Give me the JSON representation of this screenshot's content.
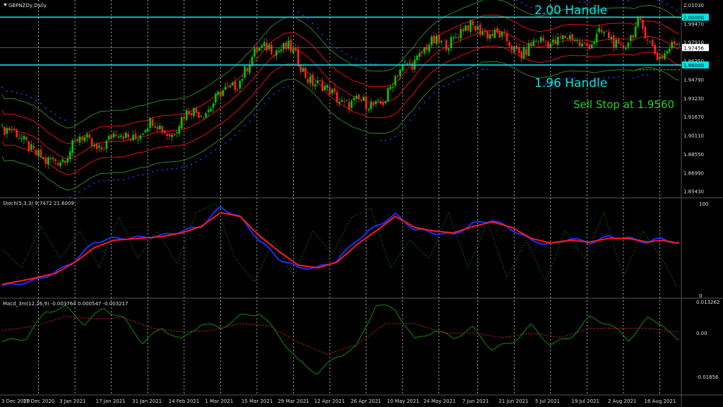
{
  "symbol_label": "GBPNZDy,Daily",
  "annotations": {
    "upper_handle": "2.00 Handle",
    "lower_handle": "1.96 Handle",
    "sell_stop": "Sell Stop at 1.9560"
  },
  "colors": {
    "background": "#000000",
    "bull_candle": "#00c800",
    "bear_candle": "#ff2020",
    "handle_line": "#00e5e5",
    "bollinger": "#2f7f2f",
    "envelope": "#e01010",
    "psar": "#2a3cff",
    "stoch_main": "#1e2dff",
    "stoch_signal": "#ff1a1a",
    "macd_main": "#0f8a0f",
    "macd_signal": "#c82020",
    "sell_stop_text": "#22d022"
  },
  "chart_data": [
    {
      "type": "candlestick",
      "title": "GBPNZDy,Daily",
      "price_axis_labels": [
        "2.01030",
        "2.00000",
        "1.99470",
        "1.97910",
        "1.97456",
        "1.96350",
        "1.96000",
        "1.94790",
        "1.93230",
        "1.91670",
        "1.90110",
        "1.88550",
        "1.86990",
        "1.85430"
      ],
      "ylim": [
        1.85,
        2.012
      ],
      "handles": [
        2.0,
        1.96
      ],
      "current_price": 1.97456,
      "sell_stop": 1.956,
      "date_labels": [
        "3 Dec 2020",
        "17 Dec 2020",
        "3 Jan 2021",
        "17 Jan 2021",
        "31 Jan 2021",
        "14 Feb 2021",
        "1 Mar 2021",
        "15 Mar 2021",
        "29 Mar 2021",
        "12 Apr 2021",
        "26 Apr 2021",
        "10 May 2021",
        "24 May 2021",
        "7 Jun 2021",
        "21 Jun 2021",
        "5 Jul 2021",
        "19 Jul 2021",
        "2 Aug 2021",
        "16 Aug 2021"
      ],
      "close_path": [
        [
          0,
          1.905
        ],
        [
          10,
          1.898
        ],
        [
          18,
          1.875
        ],
        [
          25,
          1.885
        ],
        [
          32,
          1.897
        ],
        [
          40,
          1.892
        ],
        [
          47,
          1.9
        ],
        [
          55,
          1.902
        ],
        [
          62,
          1.91
        ],
        [
          70,
          1.905
        ],
        [
          78,
          1.92
        ],
        [
          86,
          1.926
        ],
        [
          94,
          1.94
        ],
        [
          102,
          1.962
        ],
        [
          110,
          1.978
        ],
        [
          118,
          1.972
        ],
        [
          126,
          1.952
        ],
        [
          134,
          1.936
        ],
        [
          142,
          1.93
        ],
        [
          150,
          1.925
        ],
        [
          158,
          1.933
        ],
        [
          166,
          1.96
        ],
        [
          174,
          1.972
        ],
        [
          182,
          1.98
        ],
        [
          190,
          1.988
        ],
        [
          198,
          1.992
        ],
        [
          206,
          1.98
        ],
        [
          214,
          1.972
        ],
        [
          222,
          1.978
        ],
        [
          230,
          1.984
        ],
        [
          238,
          1.976
        ],
        [
          246,
          1.986
        ],
        [
          254,
          1.975
        ],
        [
          262,
          1.992
        ],
        [
          270,
          1.97
        ],
        [
          278,
          1.975
        ]
      ]
    },
    {
      "type": "line",
      "title": "Stoch(5,3,3) 9.7472 21.6009",
      "ylim": [
        0,
        100
      ],
      "y_tick_labels": [
        "100",
        "0"
      ],
      "main_path": [
        [
          0,
          10
        ],
        [
          12,
          15
        ],
        [
          22,
          25
        ],
        [
          30,
          38
        ],
        [
          38,
          58
        ],
        [
          46,
          62
        ],
        [
          56,
          63
        ],
        [
          66,
          65
        ],
        [
          74,
          70
        ],
        [
          82,
          75
        ],
        [
          90,
          96
        ],
        [
          98,
          85
        ],
        [
          106,
          60
        ],
        [
          114,
          40
        ],
        [
          122,
          30
        ],
        [
          130,
          30
        ],
        [
          138,
          38
        ],
        [
          146,
          60
        ],
        [
          154,
          75
        ],
        [
          162,
          88
        ],
        [
          170,
          72
        ],
        [
          178,
          68
        ],
        [
          186,
          66
        ],
        [
          194,
          78
        ],
        [
          202,
          82
        ],
        [
          210,
          72
        ],
        [
          218,
          60
        ],
        [
          226,
          55
        ],
        [
          234,
          62
        ],
        [
          242,
          57
        ],
        [
          250,
          64
        ],
        [
          258,
          62
        ],
        [
          266,
          58
        ],
        [
          272,
          62
        ],
        [
          278,
          57
        ]
      ],
      "signal_path": [
        [
          0,
          12
        ],
        [
          12,
          18
        ],
        [
          22,
          24
        ],
        [
          30,
          36
        ],
        [
          38,
          52
        ],
        [
          46,
          60
        ],
        [
          56,
          62
        ],
        [
          66,
          64
        ],
        [
          74,
          68
        ],
        [
          82,
          75
        ],
        [
          90,
          90
        ],
        [
          98,
          86
        ],
        [
          106,
          65
        ],
        [
          114,
          48
        ],
        [
          122,
          33
        ],
        [
          130,
          30
        ],
        [
          138,
          36
        ],
        [
          146,
          55
        ],
        [
          154,
          70
        ],
        [
          162,
          86
        ],
        [
          170,
          74
        ],
        [
          178,
          70
        ],
        [
          186,
          68
        ],
        [
          194,
          75
        ],
        [
          202,
          80
        ],
        [
          210,
          74
        ],
        [
          218,
          62
        ],
        [
          226,
          57
        ],
        [
          234,
          60
        ],
        [
          242,
          58
        ],
        [
          250,
          62
        ],
        [
          258,
          62
        ],
        [
          266,
          58
        ],
        [
          272,
          60
        ],
        [
          278,
          57
        ]
      ],
      "fast_path": [
        [
          0,
          50
        ],
        [
          8,
          30
        ],
        [
          16,
          75
        ],
        [
          24,
          40
        ],
        [
          32,
          70
        ],
        [
          40,
          30
        ],
        [
          48,
          85
        ],
        [
          56,
          40
        ],
        [
          64,
          70
        ],
        [
          72,
          35
        ],
        [
          80,
          90
        ],
        [
          88,
          100
        ],
        [
          96,
          40
        ],
        [
          104,
          15
        ],
        [
          112,
          60
        ],
        [
          120,
          20
        ],
        [
          128,
          70
        ],
        [
          136,
          45
        ],
        [
          144,
          85
        ],
        [
          152,
          95
        ],
        [
          160,
          30
        ],
        [
          168,
          60
        ],
        [
          176,
          40
        ],
        [
          184,
          90
        ],
        [
          192,
          30
        ],
        [
          200,
          80
        ],
        [
          208,
          20
        ],
        [
          216,
          60
        ],
        [
          224,
          15
        ],
        [
          232,
          70
        ],
        [
          240,
          40
        ],
        [
          248,
          90
        ],
        [
          256,
          20
        ],
        [
          264,
          70
        ],
        [
          272,
          40
        ],
        [
          278,
          10
        ]
      ]
    },
    {
      "type": "line",
      "title": "Macd_3m(12,26,9) -0.003764 0.000547 -0.003217",
      "ylim": [
        -0.01856,
        0.013262
      ],
      "y_tick_labels": [
        "0.013262",
        "0.00",
        "-0.01856"
      ],
      "macd_path": [
        [
          0,
          -0.004
        ],
        [
          10,
          -0.002
        ],
        [
          18,
          0.009
        ],
        [
          26,
          0.011
        ],
        [
          34,
          0.004
        ],
        [
          42,
          0.0105
        ],
        [
          50,
          0.006
        ],
        [
          58,
          -0.004
        ],
        [
          66,
          0.002
        ],
        [
          74,
          -0.003
        ],
        [
          82,
          0.004
        ],
        [
          90,
          0.002
        ],
        [
          98,
          0.007
        ],
        [
          106,
          0.0085
        ],
        [
          114,
          -0.001
        ],
        [
          122,
          -0.012
        ],
        [
          130,
          -0.017
        ],
        [
          138,
          -0.01
        ],
        [
          146,
          -0.006
        ],
        [
          154,
          0.012
        ],
        [
          162,
          0.01
        ],
        [
          170,
          -0.003
        ],
        [
          178,
          0.001
        ],
        [
          186,
          -0.002
        ],
        [
          194,
          0.002
        ],
        [
          202,
          -0.007
        ],
        [
          210,
          -0.004
        ],
        [
          218,
          0.003
        ],
        [
          226,
          -0.005
        ],
        [
          234,
          -0.002
        ],
        [
          242,
          0.0065
        ],
        [
          250,
          0.004
        ],
        [
          258,
          -0.003
        ],
        [
          266,
          0.006
        ],
        [
          272,
          0.004
        ],
        [
          278,
          -0.0035
        ]
      ],
      "signal_path": [
        [
          0,
          0.001
        ],
        [
          14,
          0.003
        ],
        [
          26,
          0.007
        ],
        [
          38,
          0.006
        ],
        [
          50,
          0.0065
        ],
        [
          62,
          0.002
        ],
        [
          74,
          0.0005
        ],
        [
          86,
          0.001
        ],
        [
          98,
          0.004
        ],
        [
          110,
          0.003
        ],
        [
          122,
          -0.004
        ],
        [
          134,
          -0.009
        ],
        [
          146,
          -0.005
        ],
        [
          158,
          0.004
        ],
        [
          170,
          0.004
        ],
        [
          182,
          0.0
        ],
        [
          194,
          0.0
        ],
        [
          206,
          -0.002
        ],
        [
          218,
          0.0
        ],
        [
          230,
          -0.002
        ],
        [
          242,
          0.002
        ],
        [
          254,
          0.002
        ],
        [
          266,
          0.002
        ],
        [
          278,
          0.0005
        ]
      ]
    }
  ]
}
